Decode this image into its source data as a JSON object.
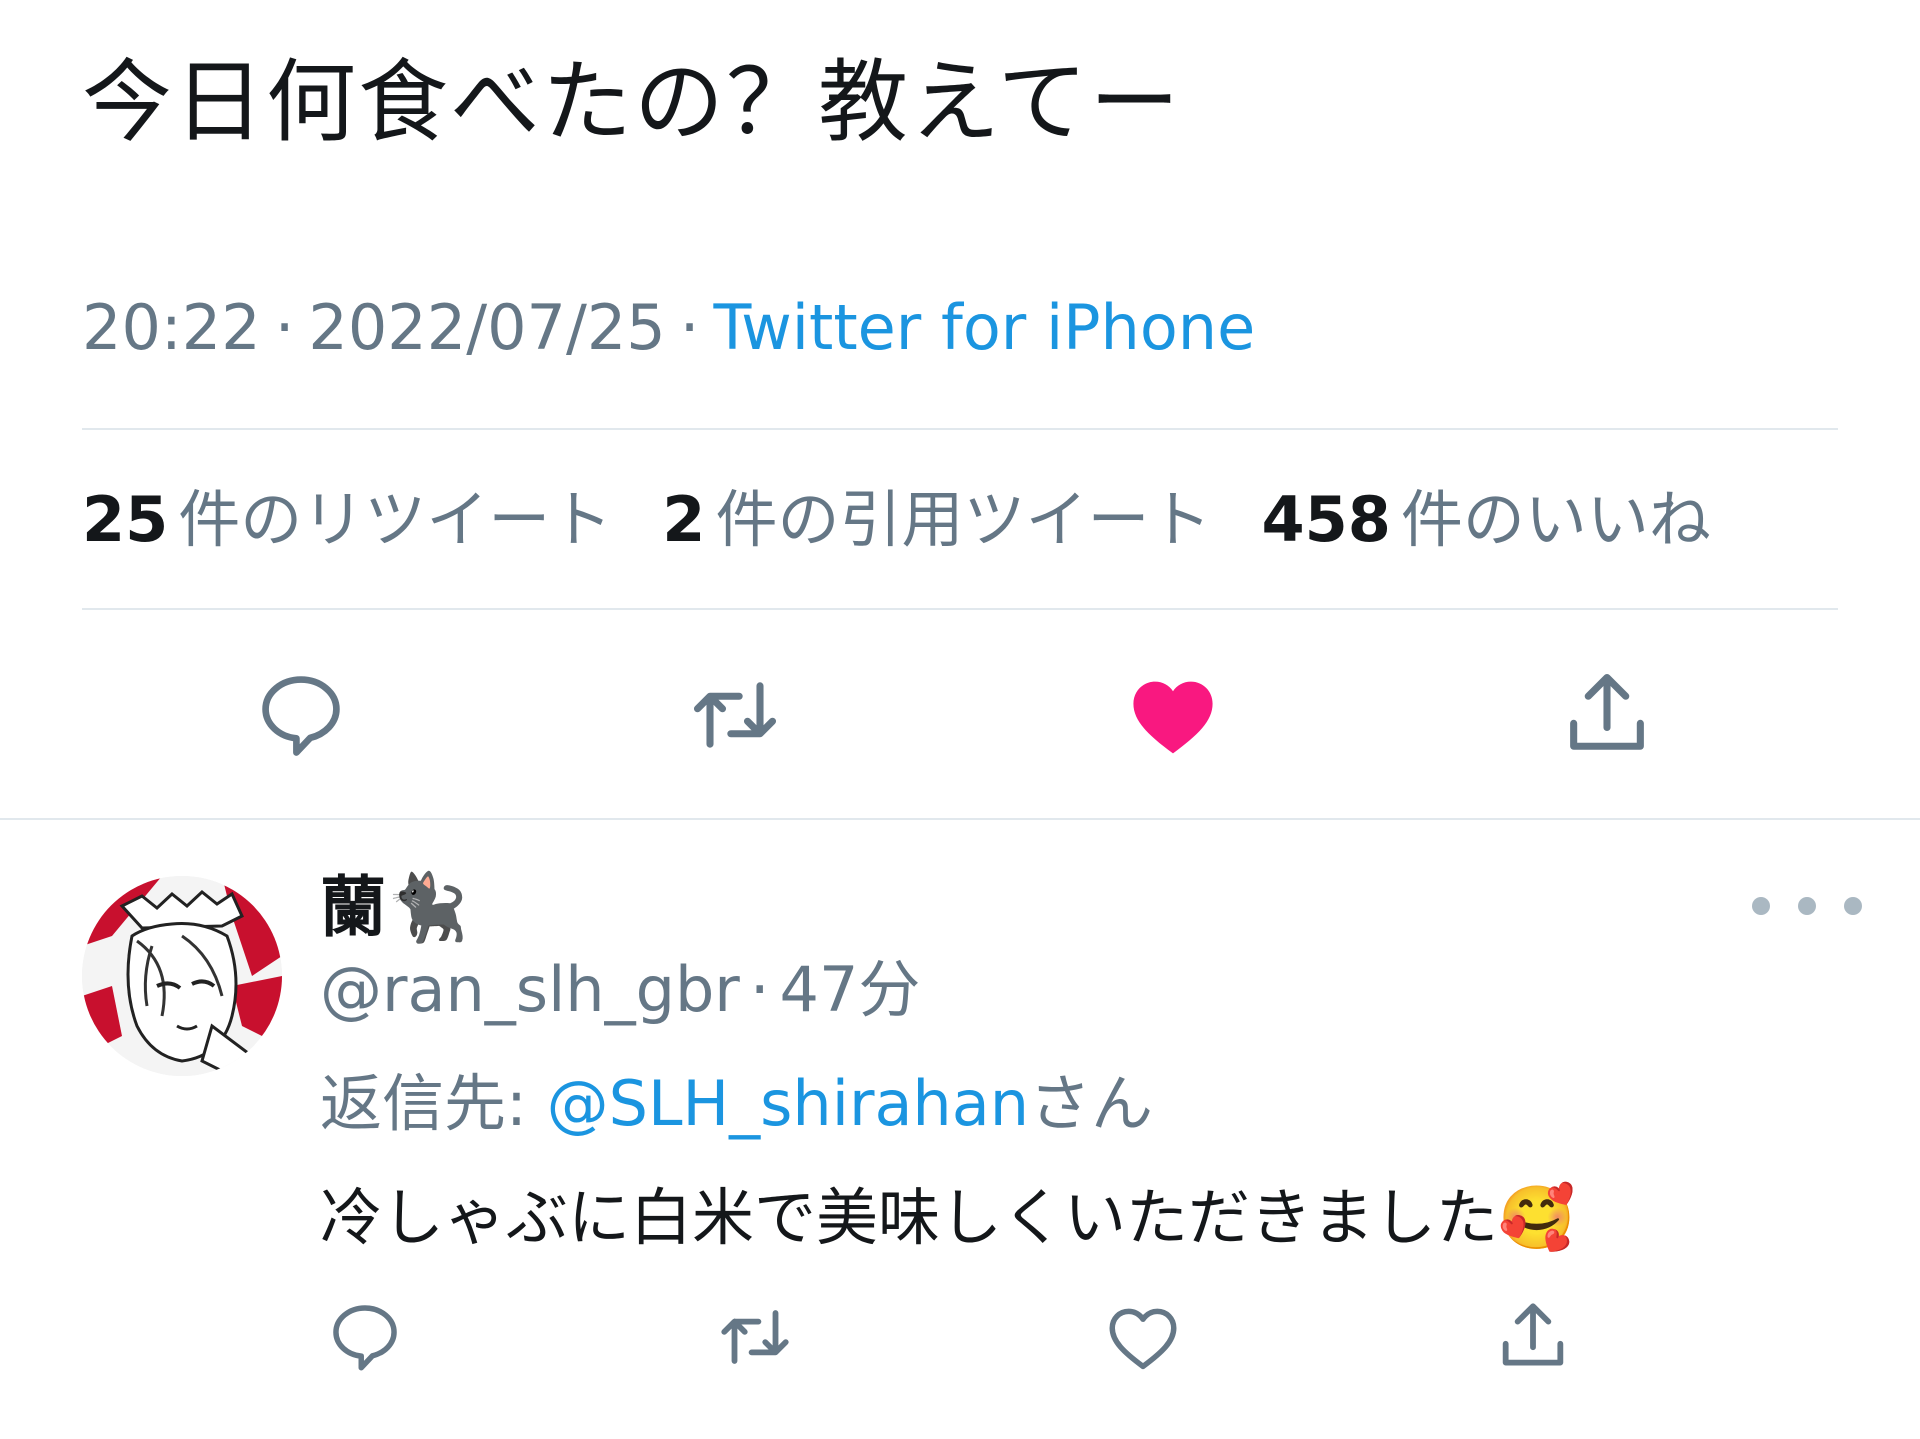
{
  "tweet": {
    "text": "今日何食べたの？教えてー",
    "time": "20:22",
    "date": "2022/07/25",
    "separator": "·",
    "source": "Twitter for iPhone"
  },
  "stats": {
    "retweets_count": "25",
    "retweets_label": "件のリツイート",
    "quotes_count": "2",
    "quotes_label": "件の引用ツイート",
    "likes_count": "458",
    "likes_label": "件のいいね"
  },
  "actions": {
    "reply_icon": "reply-icon",
    "retweet_icon": "retweet-icon",
    "like_icon": "heart-filled-icon",
    "share_icon": "share-icon",
    "like_color": "#f91880",
    "icon_color": "#657786"
  },
  "reply": {
    "display_name": "蘭🐈‍⬛",
    "handle": "@ran_slh_gbr",
    "separator": "·",
    "time_ago": "47分",
    "reply_to_label": "返信先:",
    "reply_to_mention": "@SLH_shirahan",
    "reply_to_suffix": "さん",
    "text": "冷しゃぶに白米で美味しくいただきました🥰",
    "more_icon": "more-icon",
    "actions": {
      "reply_icon": "reply-icon",
      "retweet_icon": "retweet-icon",
      "like_icon": "heart-outline-icon",
      "share_icon": "share-icon"
    }
  }
}
